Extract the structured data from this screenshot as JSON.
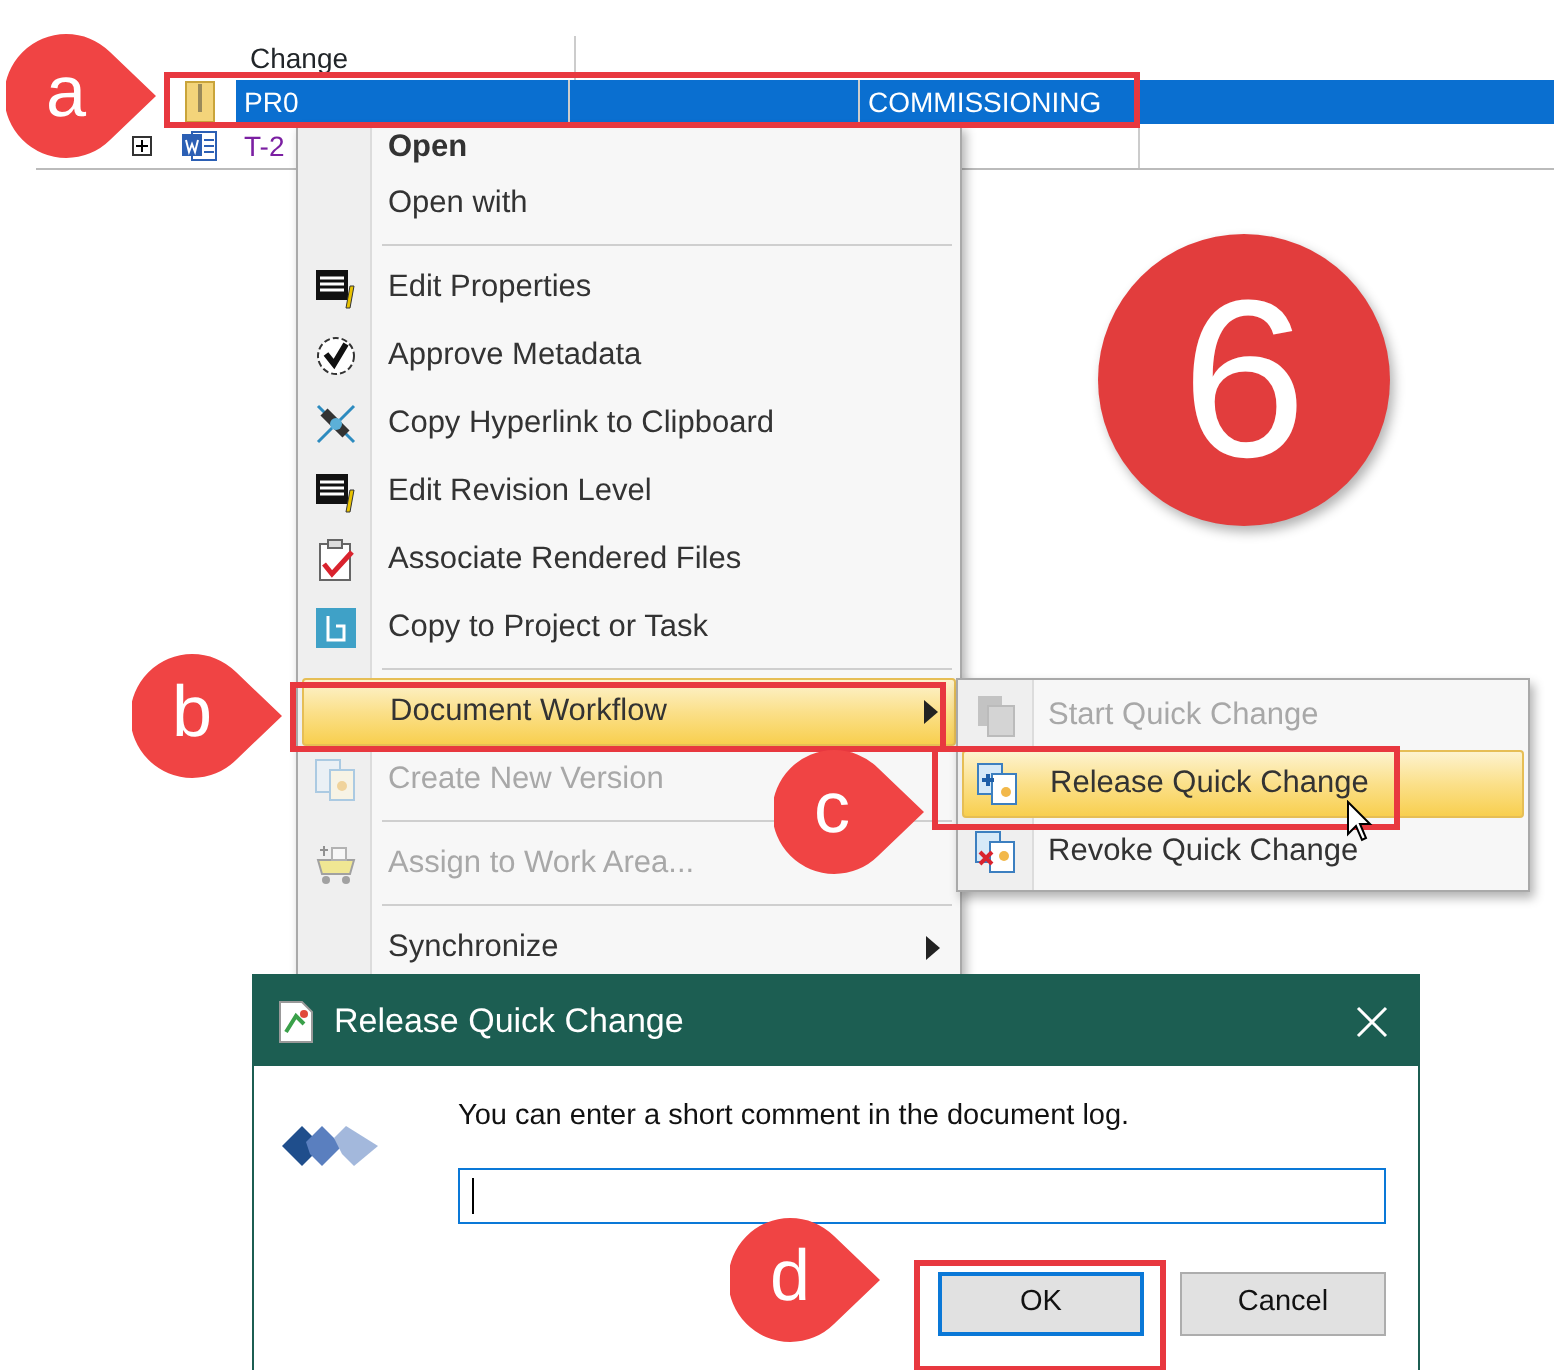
{
  "tree": {
    "header": "Change",
    "rows": [
      {
        "kind": "archive",
        "name": "PR0",
        "column_3": "COMMISSIONING",
        "selected": true
      },
      {
        "kind": "word",
        "name": "T-2",
        "expanded": false,
        "selected": false
      }
    ]
  },
  "context_menu": {
    "items": [
      {
        "kind": "plain",
        "label": "Open",
        "default": true,
        "disabled": false,
        "selected": false,
        "submenu": false
      },
      {
        "kind": "plain",
        "label": "Open with",
        "default": false,
        "disabled": false,
        "selected": false,
        "submenu": false
      },
      {
        "kind": "separator"
      },
      {
        "kind": "properties",
        "label": "Edit Properties",
        "default": false,
        "disabled": false,
        "selected": false,
        "submenu": false
      },
      {
        "kind": "approve",
        "label": "Approve Metadata",
        "default": false,
        "disabled": false,
        "selected": false,
        "submenu": false
      },
      {
        "kind": "hyperlink",
        "label": "Copy Hyperlink to Clipboard",
        "default": false,
        "disabled": false,
        "selected": false,
        "submenu": false
      },
      {
        "kind": "properties",
        "label": "Edit Revision Level",
        "default": false,
        "disabled": false,
        "selected": false,
        "submenu": false
      },
      {
        "kind": "clipboard",
        "label": "Associate Rendered Files",
        "default": false,
        "disabled": false,
        "selected": false,
        "submenu": false
      },
      {
        "kind": "project",
        "label": "Copy to Project or Task",
        "default": false,
        "disabled": false,
        "selected": false,
        "submenu": false
      },
      {
        "kind": "separator"
      },
      {
        "kind": "plain",
        "label": "Document Workflow",
        "default": false,
        "disabled": false,
        "selected": true,
        "submenu": true
      },
      {
        "kind": "version",
        "label": "Create New Version",
        "default": false,
        "disabled": true,
        "selected": false,
        "submenu": false
      },
      {
        "kind": "separator"
      },
      {
        "kind": "cart",
        "label": "Assign to Work Area...",
        "default": false,
        "disabled": true,
        "selected": false,
        "submenu": false
      },
      {
        "kind": "separator"
      },
      {
        "kind": "plain",
        "label": "Synchronize",
        "default": false,
        "disabled": false,
        "selected": false,
        "submenu": true
      }
    ]
  },
  "submenu": {
    "items": [
      {
        "kind": "pages",
        "label": "Start Quick Change",
        "disabled": true,
        "selected": false
      },
      {
        "kind": "release",
        "label": "Release Quick Change",
        "disabled": false,
        "selected": true
      },
      {
        "kind": "revoke",
        "label": "Revoke Quick Change",
        "disabled": false,
        "selected": false
      }
    ]
  },
  "dialog": {
    "title": "Release Quick Change",
    "message": "You can enter a short comment in the document log.",
    "buttons": [
      {
        "label": "OK",
        "default": true
      },
      {
        "label": "Cancel",
        "default": false
      }
    ]
  },
  "step_badge": "6",
  "callouts": [
    {
      "label": "a"
    },
    {
      "label": "b"
    },
    {
      "label": "c"
    },
    {
      "label": "d"
    }
  ]
}
